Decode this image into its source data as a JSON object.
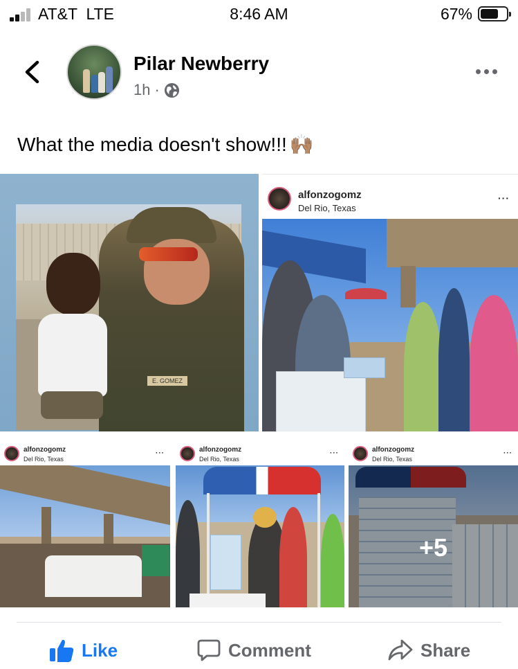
{
  "status_bar": {
    "carrier": "AT&T  LTE",
    "time": "8:46 AM",
    "battery_percent": "67%",
    "battery_level": 0.67
  },
  "post": {
    "author": "Pilar Newberry",
    "time_ago": "1h",
    "separator": "·",
    "text": "What the media doesn't show!!!",
    "emoji": "🙌🏽",
    "icons": {
      "back": "chevron-left-icon",
      "privacy": "globe-icon",
      "more": "more-options-icon"
    }
  },
  "photos": {
    "embedded_posts": [
      {
        "username": "alfonzogomz",
        "location": "Del Rio, Texas",
        "menu": "···"
      },
      {
        "username": "alfonzogomz",
        "location": "Del Rio, Texas",
        "menu": "···"
      },
      {
        "username": "alfonzogomz",
        "location": "Del Rio, Texas",
        "menu": "···"
      },
      {
        "username": "alfonzogomz",
        "location": "Del Rio, Texas",
        "menu": "···"
      }
    ],
    "badge_name": "E. GOMEZ",
    "more_count": "+5"
  },
  "actions": {
    "like": "Like",
    "comment": "Comment",
    "share": "Share"
  },
  "colors": {
    "accent": "#1877f2",
    "secondary_text": "#65676b",
    "primary_text": "#050505"
  }
}
